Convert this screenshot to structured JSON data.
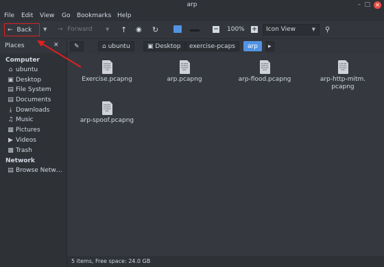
{
  "window": {
    "title": "arp"
  },
  "menu": [
    "File",
    "Edit",
    "View",
    "Go",
    "Bookmarks",
    "Help"
  ],
  "toolbar": {
    "back_label": "Back",
    "forward_label": "Forward",
    "zoom_level": "100%",
    "view_mode": "Icon View"
  },
  "sidebar": {
    "header": "Places",
    "sections": [
      {
        "title": "Computer",
        "items": [
          {
            "label": "ubuntu",
            "icon": "home-icon"
          },
          {
            "label": "Desktop",
            "icon": "desktop-icon"
          },
          {
            "label": "File System",
            "icon": "drive-icon"
          },
          {
            "label": "Documents",
            "icon": "documents-icon"
          },
          {
            "label": "Downloads",
            "icon": "downloads-icon"
          },
          {
            "label": "Music",
            "icon": "music-icon"
          },
          {
            "label": "Pictures",
            "icon": "pictures-icon"
          },
          {
            "label": "Videos",
            "icon": "videos-icon"
          },
          {
            "label": "Trash",
            "icon": "trash-icon"
          }
        ]
      },
      {
        "title": "Network",
        "items": [
          {
            "label": "Browse Netw…",
            "icon": "network-icon"
          }
        ]
      }
    ]
  },
  "breadcrumb": [
    "ubuntu",
    "Desktop",
    "exercise-pcaps",
    "arp"
  ],
  "files": [
    {
      "name": "Exercise.pcapng"
    },
    {
      "name": "arp.pcapng"
    },
    {
      "name": "arp-flood.pcapng"
    },
    {
      "name": "arp-http-mitm.\npcapng"
    },
    {
      "name": "arp-spoof.pcapng"
    }
  ],
  "status": {
    "text": "5 items, Free space: 24.0 GB"
  },
  "colors": {
    "accent": "#5294e2",
    "annotation": "#e02020"
  }
}
